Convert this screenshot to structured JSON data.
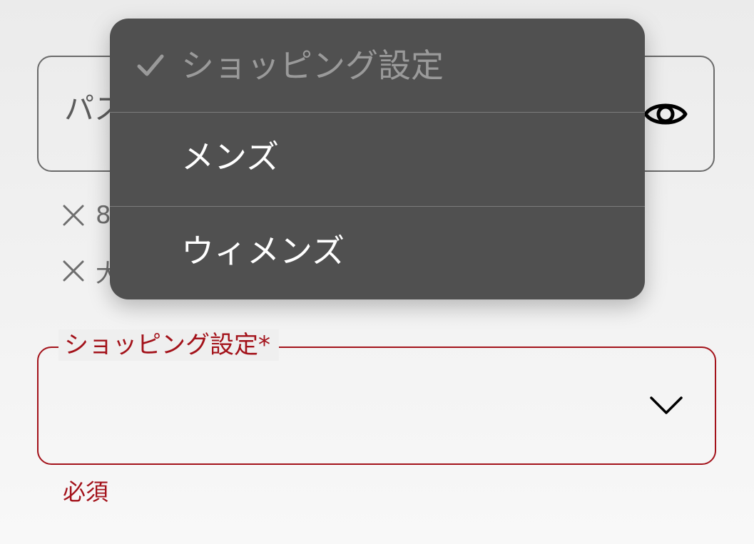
{
  "password": {
    "label": "パスワード"
  },
  "rules": [
    {
      "text": "8"
    },
    {
      "text": "大"
    }
  ],
  "shopping": {
    "label": "ショッピング設定*",
    "error": "必須"
  },
  "dropdown": {
    "items": [
      {
        "label": "ショッピング設定",
        "selected": true
      },
      {
        "label": "メンズ",
        "selected": false
      },
      {
        "label": "ウィメンズ",
        "selected": false
      }
    ]
  },
  "colors": {
    "error": "#a3121a",
    "menu_bg": "#505050",
    "menu_placeholder": "#9a9a9a",
    "field_border": "#6a6a6a"
  },
  "icons": {
    "password_toggle": "eye-icon",
    "rule_status": "x-icon",
    "select_chevron": "chevron-down-icon",
    "selected_mark": "check-icon"
  }
}
